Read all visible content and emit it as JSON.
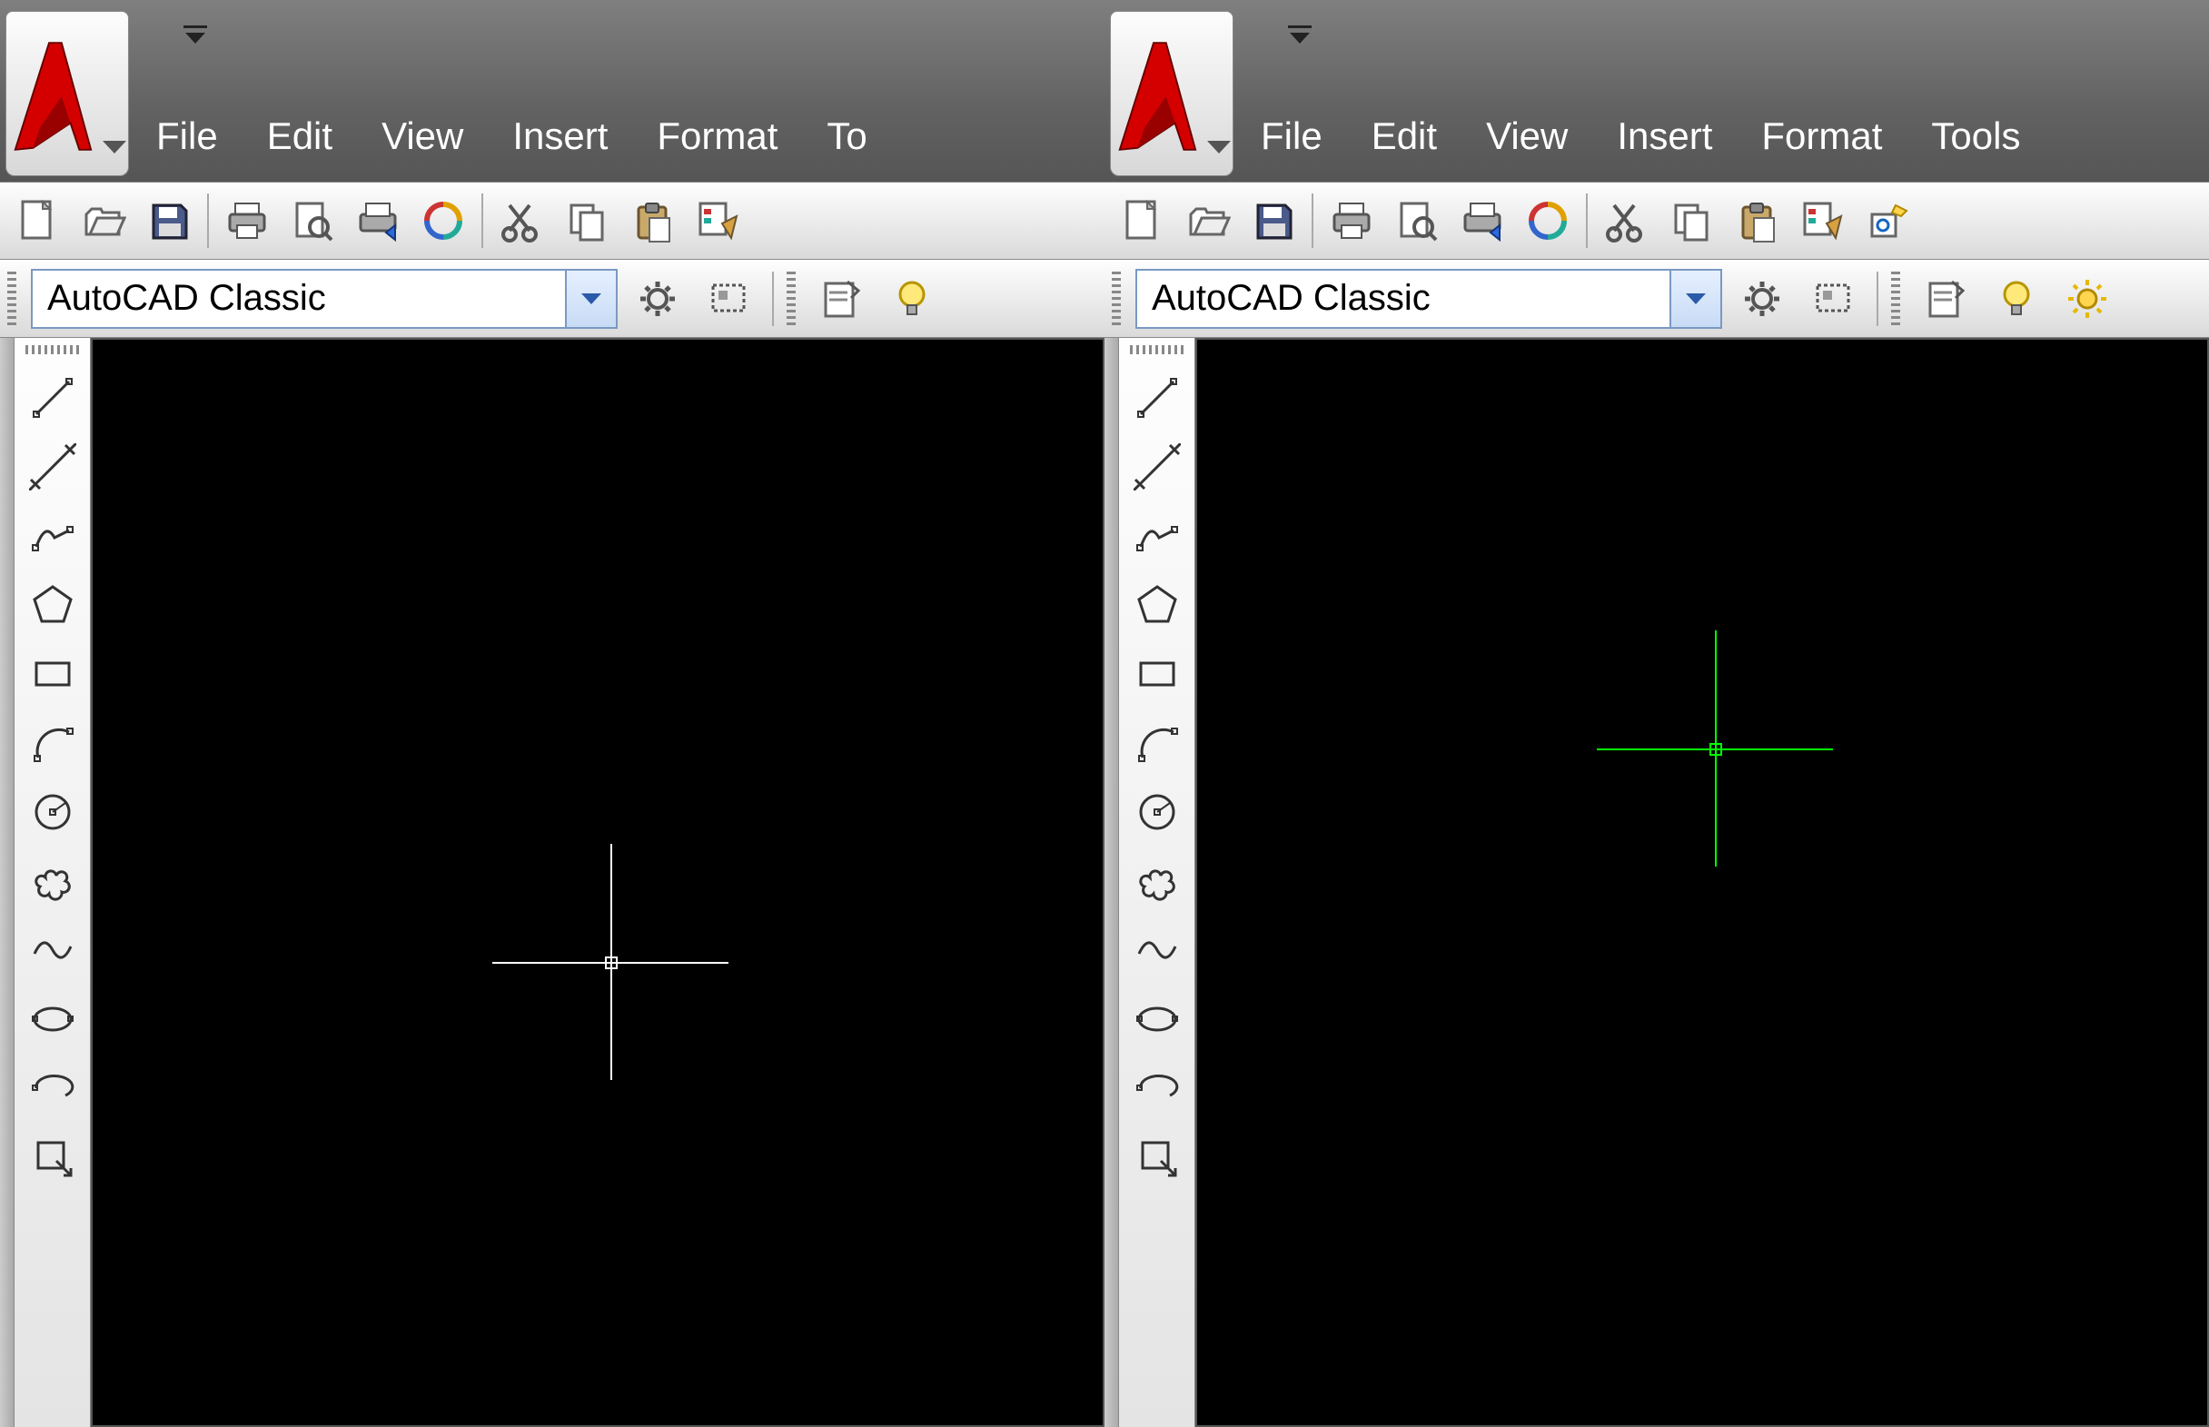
{
  "menus": {
    "file": "File",
    "edit": "Edit",
    "view": "View",
    "insert": "Insert",
    "format": "Format",
    "tools_trunc": "To",
    "tools": "Tools"
  },
  "workspace": {
    "label": "AutoCAD Classic"
  },
  "icons": {
    "new": "new-icon",
    "open": "open-icon",
    "save": "save-icon",
    "print": "print-icon",
    "preview": "preview-icon",
    "publish": "publish-icon",
    "dwf": "dwf-icon",
    "cut": "cut-icon",
    "copy": "copy-icon",
    "paste": "paste-icon",
    "match": "match-icon",
    "block": "block-icon",
    "gear": "gear-icon",
    "ws": "workspace-settings-icon",
    "prop": "properties-icon",
    "bulb": "bulb-off-icon",
    "sun": "sun-on-icon",
    "line": "line-icon",
    "cline": "construction-line-icon",
    "pline": "polyline-icon",
    "polygon": "polygon-icon",
    "rect": "rectangle-icon",
    "arc": "arc-icon",
    "circle": "circle-icon",
    "cloud": "revision-cloud-icon",
    "spline": "spline-icon",
    "ellipse": "ellipse-icon",
    "earc": "ellipse-arc-icon",
    "iblock": "insert-block-icon"
  },
  "crosshair": {
    "color_left": "#ffffff",
    "color_right": "#00ff00"
  }
}
